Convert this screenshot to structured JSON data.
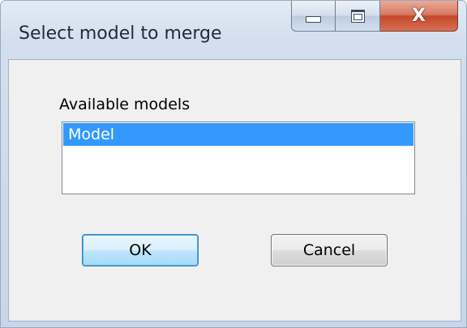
{
  "window": {
    "title": "Select model to merge",
    "caption_buttons": {
      "minimize_icon": "minimize-icon",
      "maximize_icon": "maximize-icon",
      "close_icon": "close-icon",
      "close_glyph": "X"
    }
  },
  "dialog": {
    "list_label": "Available models",
    "models": [
      {
        "label": "Model",
        "selected": true
      }
    ],
    "ok_label": "OK",
    "cancel_label": "Cancel"
  },
  "colors": {
    "selection": "#3399ff",
    "client_bg": "#f0f0f0",
    "close_button": "#c4472b"
  }
}
